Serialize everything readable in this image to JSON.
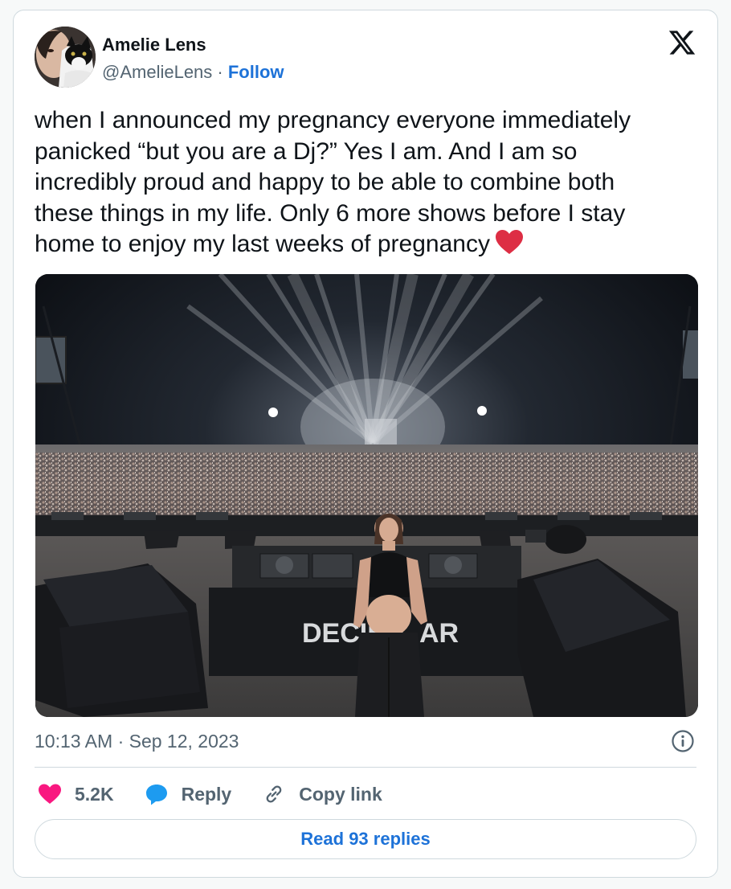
{
  "author": {
    "name": "Amelie Lens",
    "handle": "@AmelieLens",
    "separator": " · ",
    "follow_label": "Follow"
  },
  "platform_icon": "x-logo-icon",
  "tweet": {
    "text": "when I announced my pregnancy everyone immediately panicked “but you are a Dj?” Yes I am. And I am so incredibly proud and happy to be able to combine both these things in my life. Only 6 more shows before I stay home to enjoy my last weeks of pregnancy",
    "emoji": "red-heart"
  },
  "photo": {
    "banner_text": "DECIBE",
    "banner_text_2": "AR"
  },
  "meta": {
    "timestamp": "10:13 AM · Sep 12, 2023"
  },
  "actions": {
    "likes": "5.2K",
    "reply_label": "Reply",
    "copy_link_label": "Copy link"
  },
  "read_replies_label": "Read 93 replies",
  "colors": {
    "accent": "#1d72d8",
    "like": "#f91880",
    "reply": "#1d9bf0",
    "muted": "#536471"
  }
}
